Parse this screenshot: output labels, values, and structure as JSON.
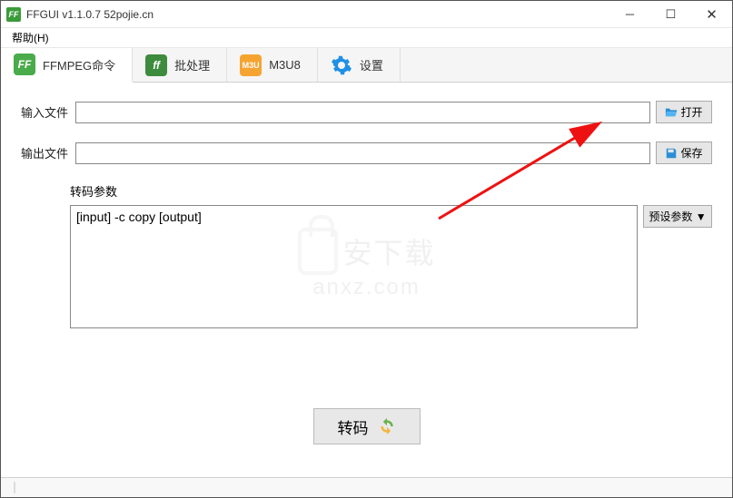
{
  "titlebar": {
    "icon_text": "FF",
    "title": "FFGUI v1.1.0.7    52pojie.cn"
  },
  "menubar": {
    "help": "帮助(H)"
  },
  "tabs": [
    {
      "label": "FFMPEG命令",
      "icon": "FF"
    },
    {
      "label": "批处理",
      "icon": "ff"
    },
    {
      "label": "M3U8",
      "icon": "M3U"
    },
    {
      "label": "设置",
      "icon": "gear"
    }
  ],
  "input_file": {
    "label": "输入文件",
    "value": "",
    "button": "打开"
  },
  "output_file": {
    "label": "输出文件",
    "value": "",
    "button": "保存"
  },
  "params": {
    "label": "转码参数",
    "value": "[input] -c copy [output]",
    "preset_button": "预设参数 ▼"
  },
  "transcode_button": "转码",
  "watermark": {
    "line1": "安下载",
    "line2": "anxz.com"
  }
}
